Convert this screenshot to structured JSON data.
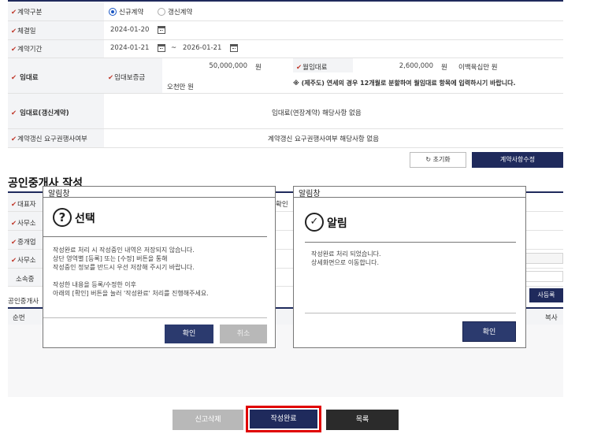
{
  "contract_form": {
    "contract_type": {
      "label": "계약구분",
      "options": [
        "신규계약",
        "갱신계약"
      ],
      "selected": "신규계약"
    },
    "conclusion_date": {
      "label": "체결일",
      "value": "2024-01-20"
    },
    "contract_period": {
      "label": "계약기간",
      "start": "2024-01-21",
      "separator": "~",
      "end": "2026-01-21"
    },
    "rent": {
      "label": "임대료",
      "deposit_label": "임대보증금",
      "deposit_value": "50,000,000",
      "deposit_unit": "원",
      "deposit_korean": "오천만 원",
      "monthly_label": "월임대료",
      "monthly_value": "2,600,000",
      "monthly_unit": "원",
      "monthly_korean": "이백육십만 원",
      "note": "※ (제주도) 연세의 경우 12개월로 분할하여 월임대료 항목에 입력하시기 바랍니다."
    },
    "rent_renewal": {
      "label": "임대료(갱신계약)",
      "value": "임대료(연장계약) 해당사항 없음"
    },
    "renewal_right": {
      "label": "계약갱신 요구권행사여부",
      "value": "계약갱신 요구권행사여부 해당사항 없음"
    },
    "reset_button": "초기화",
    "modify_button": "계약사항수정"
  },
  "agent_section": {
    "title": "공인중개사 작성",
    "rows": [
      {
        "label": "대표자"
      },
      {
        "label": "사무소"
      },
      {
        "label": "중개업"
      },
      {
        "label": "사무소"
      }
    ],
    "sub_row_label": "소속중",
    "list_label": "공인중개사",
    "col_num": "순번",
    "col_right": "복사",
    "confirm_fragment": "확인",
    "register_fragment": "사등록"
  },
  "modal_select": {
    "window_title": "알림창",
    "heading": "선택",
    "body_lines": [
      "작성완료 처리 시 작성중인 내역은 저장되지 않습니다.",
      "상단 영역별 [등록] 또는 [수정] 버튼을 통해",
      "작성중인 정보를 반드시 우선 저장해 주시기 바랍니다.",
      "",
      "작성한 내용을 등록/수정한 이후",
      "아래의 [확인] 버튼을 눌러 '작성완료' 처리를 진행해주세요."
    ],
    "confirm_button": "확인",
    "cancel_button": "취소"
  },
  "modal_alert": {
    "window_title": "알림창",
    "heading": "알림",
    "body_lines": [
      "작성완료 처리 되었습니다.",
      "상세화면으로 이동합니다."
    ],
    "confirm_button": "확인"
  },
  "bottom_buttons": {
    "delete_report": "신고삭제",
    "complete": "작성완료",
    "list": "목록"
  },
  "colors": {
    "navy": "#1f2a5c",
    "highlight_red": "#e00000",
    "required_red": "#c0392b",
    "modal_button_navy": "#2b3a6e",
    "disabled_gray": "#b8b8b8"
  }
}
